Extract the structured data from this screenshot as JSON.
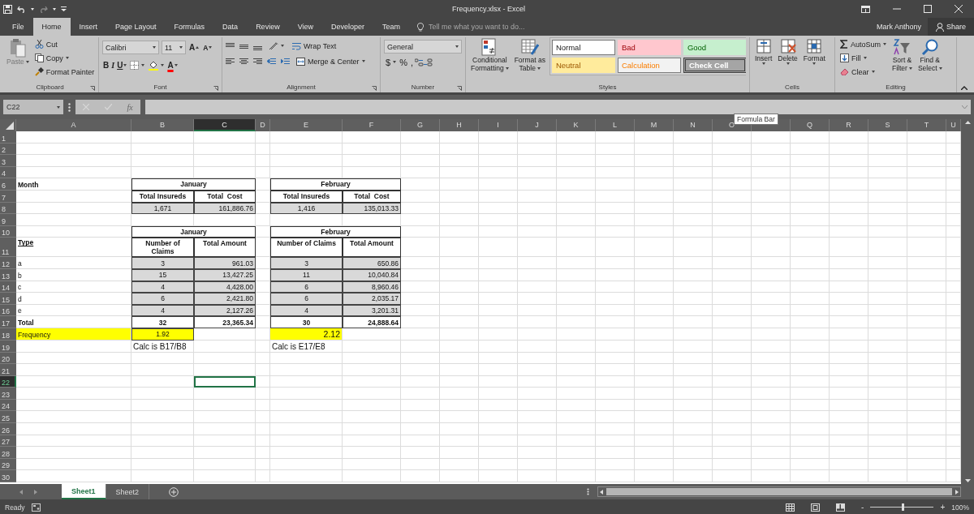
{
  "window": {
    "title": "Frequency.xlsx - Excel",
    "user": "Mark Anthony",
    "share": "Share"
  },
  "tabs": [
    {
      "label": "File",
      "selected": false
    },
    {
      "label": "Home",
      "selected": true
    },
    {
      "label": "Insert",
      "selected": false
    },
    {
      "label": "Page Layout",
      "selected": false
    },
    {
      "label": "Formulas",
      "selected": false
    },
    {
      "label": "Data",
      "selected": false
    },
    {
      "label": "Review",
      "selected": false
    },
    {
      "label": "View",
      "selected": false
    },
    {
      "label": "Developer",
      "selected": false
    },
    {
      "label": "Team",
      "selected": false
    }
  ],
  "tell_me": {
    "placeholder": "Tell me what you want to do..."
  },
  "clipboard": {
    "label": "Clipboard",
    "paste": "Paste",
    "cut": "Cut",
    "copy": "Copy",
    "format_painter": "Format Painter"
  },
  "font": {
    "label": "Font",
    "name": "Calibri",
    "size": "11",
    "grow": "A",
    "shrink": "A",
    "bold": "B",
    "italic": "I",
    "underline": "U",
    "font_color": "A"
  },
  "alignment": {
    "label": "Alignment",
    "wrap": "Wrap Text",
    "merge": "Merge & Center"
  },
  "number": {
    "label": "Number",
    "format": "General",
    "currency": "$",
    "percent": "%",
    "comma": ","
  },
  "styles": {
    "label": "Styles",
    "conditional": [
      "Conditional",
      "Formatting"
    ],
    "format_table": [
      "Format as",
      "Table"
    ],
    "gallery": [
      {
        "label": "Normal",
        "kind": "normal"
      },
      {
        "label": "Bad",
        "kind": "bad"
      },
      {
        "label": "Good",
        "kind": "good"
      },
      {
        "label": "Neutral",
        "kind": "neutral"
      },
      {
        "label": "Calculation",
        "kind": "calculation"
      },
      {
        "label": "Check Cell",
        "kind": "check"
      }
    ]
  },
  "cells": {
    "label": "Cells",
    "buttons": [
      "Insert",
      "Delete",
      "Format"
    ]
  },
  "editing": {
    "label": "Editing",
    "autosum": "AutoSum",
    "fill": "Fill",
    "clear": "Clear",
    "sort": [
      "Sort &",
      "Filter"
    ],
    "find": [
      "Find &",
      "Select"
    ]
  },
  "formula_bar": {
    "name_box": "C22",
    "function": "fx"
  },
  "tooltip": "Formula Bar",
  "sheet": {
    "columns": [
      {
        "label": "A",
        "selected": false
      },
      {
        "label": "B",
        "selected": false
      },
      {
        "label": "C",
        "selected": true
      },
      {
        "label": "D",
        "selected": false
      },
      {
        "label": "E",
        "selected": false
      },
      {
        "label": "F",
        "selected": false
      },
      {
        "label": "G",
        "selected": false
      },
      {
        "label": "H",
        "selected": false
      },
      {
        "label": "I",
        "selected": false
      },
      {
        "label": "J",
        "selected": false
      },
      {
        "label": "K",
        "selected": false
      },
      {
        "label": "L",
        "selected": false
      },
      {
        "label": "M",
        "selected": false
      },
      {
        "label": "N",
        "selected": false
      },
      {
        "label": "O",
        "selected": false
      },
      {
        "selected": false
      },
      {
        "label": "Q",
        "selected": false
      },
      {
        "label": "R",
        "selected": false
      },
      {
        "label": "S",
        "selected": false
      },
      {
        "label": "T",
        "selected": false
      },
      {
        "label": "U",
        "selected": false
      }
    ],
    "rows": [
      {
        "header": "1",
        "selected": false,
        "cells": {}
      },
      {
        "header": "2",
        "selected": false,
        "cells": {}
      },
      {
        "header": "3",
        "selected": false,
        "cells": {}
      },
      {
        "header": "4",
        "selected": false,
        "cells": {}
      },
      {
        "header": "6",
        "selected": false,
        "cells": {
          "A": {
            "text": "Month",
            "kind": "bold"
          },
          "B": {
            "text": "January",
            "kind": "heading-span"
          },
          "E": {
            "text": "February",
            "kind": "heading-span"
          }
        }
      },
      {
        "header": "7",
        "selected": false,
        "cells": {
          "B": {
            "text": "Total Insureds",
            "kind": "heading"
          },
          "C": {
            "text": "Total  Cost",
            "kind": "heading"
          },
          "E": {
            "text": "Total Insureds",
            "kind": "heading"
          },
          "F": {
            "text": "Total  Cost",
            "kind": "heading"
          }
        }
      },
      {
        "header": "8",
        "selected": false,
        "cells": {
          "B": {
            "text": "1,671",
            "kind": "shaded-center"
          },
          "C": {
            "text": "161,886.76",
            "kind": "shaded-right"
          },
          "E": {
            "text": "1,416",
            "kind": "shaded-center"
          },
          "F": {
            "text": "135,013.33",
            "kind": "shaded-right"
          }
        }
      },
      {
        "header": "9",
        "selected": false,
        "cells": {}
      },
      {
        "header": "10",
        "selected": false,
        "cells": {
          "B": {
            "text": "January",
            "kind": "heading-span"
          },
          "E": {
            "text": "February",
            "kind": "heading-span"
          }
        }
      },
      {
        "header": "11",
        "selected": false,
        "cells": {
          "A": {
            "text": "Type",
            "kind": "underlined"
          },
          "B": {
            "text": "Number of Claims",
            "kind": "heading"
          },
          "C": {
            "text": "Total Amount",
            "kind": "heading"
          },
          "E": {
            "text": "Number of Claims",
            "kind": "heading"
          },
          "F": {
            "text": "Total Amount",
            "kind": "heading"
          }
        }
      },
      {
        "header": "12",
        "selected": false,
        "cells": {
          "A": {
            "text": "a",
            "kind": "label"
          },
          "B": {
            "text": "3",
            "kind": "shaded-center"
          },
          "C": {
            "text": "961.03",
            "kind": "shaded-right"
          },
          "E": {
            "text": "3",
            "kind": "shaded-center"
          },
          "F": {
            "text": "650.86",
            "kind": "shaded-right"
          }
        }
      },
      {
        "header": "13",
        "selected": false,
        "cells": {
          "A": {
            "text": "b",
            "kind": "label"
          },
          "B": {
            "text": "15",
            "kind": "shaded-center"
          },
          "C": {
            "text": "13,427.25",
            "kind": "shaded-right"
          },
          "E": {
            "text": "11",
            "kind": "shaded-center"
          },
          "F": {
            "text": "10,040.84",
            "kind": "shaded-right"
          }
        }
      },
      {
        "header": "14",
        "selected": false,
        "cells": {
          "A": {
            "text": "c",
            "kind": "label"
          },
          "B": {
            "text": "4",
            "kind": "shaded-center"
          },
          "C": {
            "text": "4,428.00",
            "kind": "shaded-right"
          },
          "E": {
            "text": "6",
            "kind": "shaded-center"
          },
          "F": {
            "text": "8,960.46",
            "kind": "shaded-right"
          }
        }
      },
      {
        "header": "15",
        "selected": false,
        "cells": {
          "A": {
            "text": "d",
            "kind": "label"
          },
          "B": {
            "text": "6",
            "kind": "shaded-center"
          },
          "C": {
            "text": "2,421.80",
            "kind": "shaded-right"
          },
          "E": {
            "text": "6",
            "kind": "shaded-center"
          },
          "F": {
            "text": "2,035.17",
            "kind": "shaded-right"
          }
        }
      },
      {
        "header": "16",
        "selected": false,
        "cells": {
          "A": {
            "text": "e",
            "kind": "label"
          },
          "B": {
            "text": "4",
            "kind": "shaded-center"
          },
          "C": {
            "text": "2,127.26",
            "kind": "shaded-right"
          },
          "E": {
            "text": "4",
            "kind": "shaded-center"
          },
          "F": {
            "text": "3,201.31",
            "kind": "shaded-right"
          }
        }
      },
      {
        "header": "17",
        "selected": false,
        "cells": {
          "A": {
            "text": "Total",
            "kind": "bold"
          },
          "B": {
            "text": "32",
            "kind": "total-center"
          },
          "C": {
            "text": "23,365.34",
            "kind": "total-right"
          },
          "E": {
            "text": "30",
            "kind": "total-center"
          },
          "F": {
            "text": "24,888.64",
            "kind": "total-right"
          }
        }
      },
      {
        "header": "18",
        "selected": false,
        "cells": {
          "A": {
            "text": "Frequency",
            "kind": "highlight"
          },
          "B": {
            "text": "1.92",
            "kind": "highlight-center"
          },
          "E": {
            "text": "2.12",
            "kind": "highlight-right"
          }
        }
      },
      {
        "header": "19",
        "selected": false,
        "cells": {
          "B": {
            "text": "Calc is B17/B8",
            "kind": "note"
          },
          "E": {
            "text": "Calc is E17/E8",
            "kind": "note"
          }
        }
      },
      {
        "header": "20",
        "selected": false,
        "cells": {}
      },
      {
        "header": "21",
        "selected": false,
        "cells": {}
      },
      {
        "header": "22",
        "selected": true,
        "cells": {}
      },
      {
        "header": "23",
        "selected": false,
        "cells": {}
      },
      {
        "header": "24",
        "selected": false,
        "cells": {}
      },
      {
        "header": "25",
        "selected": false,
        "cells": {}
      },
      {
        "header": "26",
        "selected": false,
        "cells": {}
      },
      {
        "header": "27",
        "selected": false,
        "cells": {}
      },
      {
        "header": "28",
        "selected": false,
        "cells": {}
      },
      {
        "header": "29",
        "selected": false,
        "cells": {}
      },
      {
        "header": "30",
        "selected": false,
        "cells": {}
      }
    ]
  },
  "sheet_tabs": [
    {
      "label": "Sheet1",
      "selected": true
    },
    {
      "label": "Sheet2",
      "selected": false
    }
  ],
  "status_bar": {
    "status": "Ready",
    "zoom_out": "-",
    "zoom_in": "+",
    "zoom": "100%",
    "level": 0.5
  }
}
